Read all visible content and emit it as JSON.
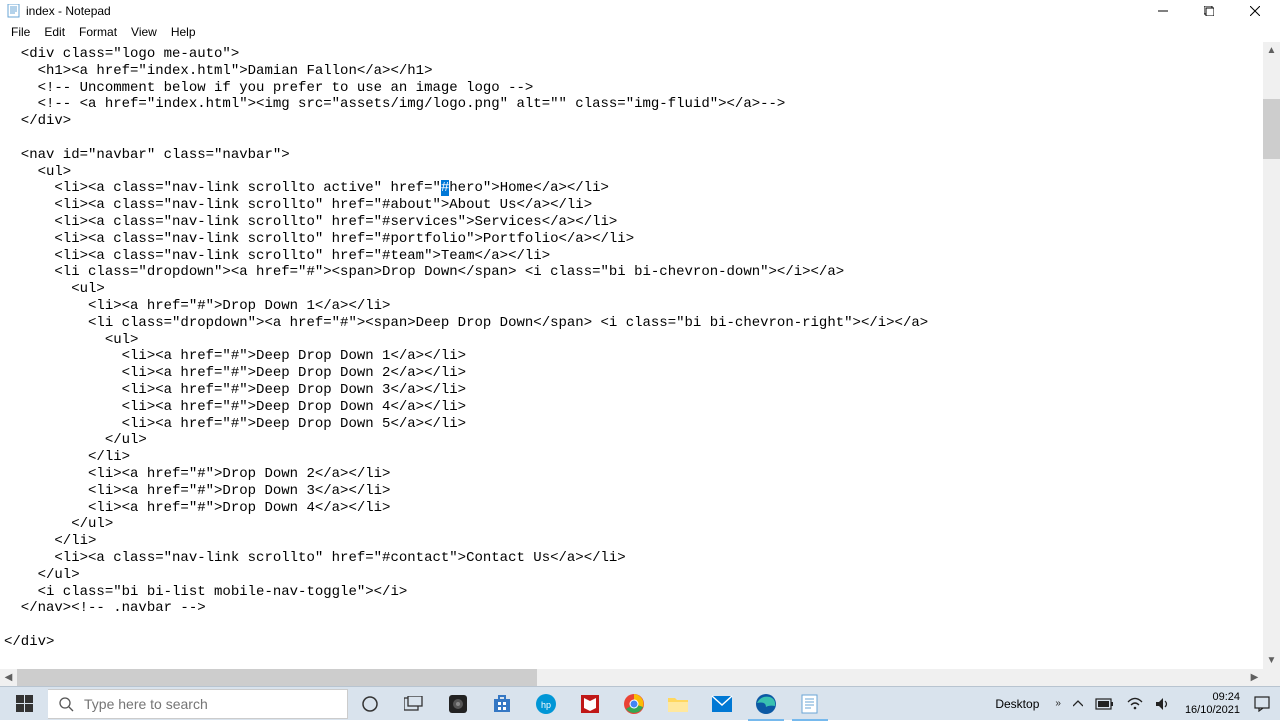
{
  "window": {
    "title": "index - Notepad"
  },
  "menu": {
    "file": "File",
    "edit": "Edit",
    "format": "Format",
    "view": "View",
    "help": "Help"
  },
  "editor": {
    "content_pre": "  <div class=\"logo me-auto\">\n    <h1><a href=\"index.html\">Damian Fallon</a></h1>\n    <!-- Uncomment below if you prefer to use an image logo -->\n    <!-- <a href=\"index.html\"><img src=\"assets/img/logo.png\" alt=\"\" class=\"img-fluid\"></a>-->\n  </div>\n\n  <nav id=\"navbar\" class=\"navbar\">\n    <ul>\n      <li><a class=\"nav-link scrollto active\" href=\"",
    "selected": "#",
    "content_post": "hero\">Home</a></li>\n      <li><a class=\"nav-link scrollto\" href=\"#about\">About Us</a></li>\n      <li><a class=\"nav-link scrollto\" href=\"#services\">Services</a></li>\n      <li><a class=\"nav-link scrollto\" href=\"#portfolio\">Portfolio</a></li>\n      <li><a class=\"nav-link scrollto\" href=\"#team\">Team</a></li>\n      <li class=\"dropdown\"><a href=\"#\"><span>Drop Down</span> <i class=\"bi bi-chevron-down\"></i></a>\n        <ul>\n          <li><a href=\"#\">Drop Down 1</a></li>\n          <li class=\"dropdown\"><a href=\"#\"><span>Deep Drop Down</span> <i class=\"bi bi-chevron-right\"></i></a>\n            <ul>\n              <li><a href=\"#\">Deep Drop Down 1</a></li>\n              <li><a href=\"#\">Deep Drop Down 2</a></li>\n              <li><a href=\"#\">Deep Drop Down 3</a></li>\n              <li><a href=\"#\">Deep Drop Down 4</a></li>\n              <li><a href=\"#\">Deep Drop Down 5</a></li>\n            </ul>\n          </li>\n          <li><a href=\"#\">Drop Down 2</a></li>\n          <li><a href=\"#\">Drop Down 3</a></li>\n          <li><a href=\"#\">Drop Down 4</a></li>\n        </ul>\n      </li>\n      <li><a class=\"nav-link scrollto\" href=\"#contact\">Contact Us</a></li>\n    </ul>\n    <i class=\"bi bi-list mobile-nav-toggle\"></i>\n  </nav><!-- .navbar -->\n\n</div>"
  },
  "taskbar": {
    "search_placeholder": "Type here to search",
    "desktop_label": "Desktop",
    "time": "09:24",
    "date": "16/10/2021"
  }
}
